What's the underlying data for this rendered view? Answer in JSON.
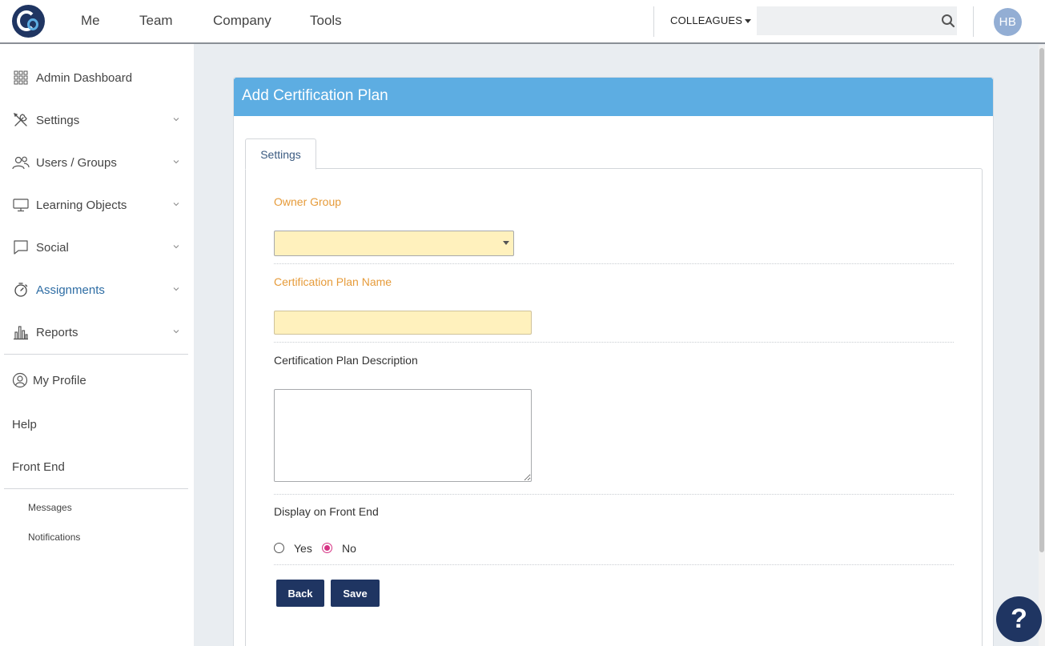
{
  "nav": {
    "items": [
      "Me",
      "Team",
      "Company",
      "Tools"
    ],
    "colleagues_label": "COLLEAGUES",
    "search_placeholder": "",
    "avatar_initials": "HB"
  },
  "sidebar": {
    "items": [
      {
        "label": "Admin Dashboard",
        "icon": "grid-icon"
      },
      {
        "label": "Settings",
        "icon": "tools-icon"
      },
      {
        "label": "Users / Groups",
        "icon": "users-icon"
      },
      {
        "label": "Learning Objects",
        "icon": "monitor-icon"
      },
      {
        "label": "Social",
        "icon": "chat-bubble-icon"
      },
      {
        "label": "Assignments",
        "icon": "stopwatch-icon"
      },
      {
        "label": "Reports",
        "icon": "bar-chart-icon"
      }
    ],
    "my_profile": "My Profile",
    "help": "Help",
    "front_end": "Front End",
    "messages": "Messages",
    "notifications": "Notifications"
  },
  "panel": {
    "title": "Add Certification Plan",
    "tab_label": "Settings",
    "owner_group_label": "Owner Group",
    "owner_group_value": "",
    "plan_name_label": "Certification Plan Name",
    "plan_name_value": "",
    "description_label": "Certification Plan Description",
    "description_value": "",
    "display_label": "Display on Front End",
    "yes_label": "Yes",
    "no_label": "No",
    "selected": "No",
    "back_label": "Back",
    "save_label": "Save"
  },
  "help_button": "?",
  "colors": {
    "primary": "#1f3562",
    "header_blue": "#5dade2",
    "required_label": "#e69b3a",
    "required_field": "#fff1bd",
    "radio_checked": "#d63384"
  }
}
